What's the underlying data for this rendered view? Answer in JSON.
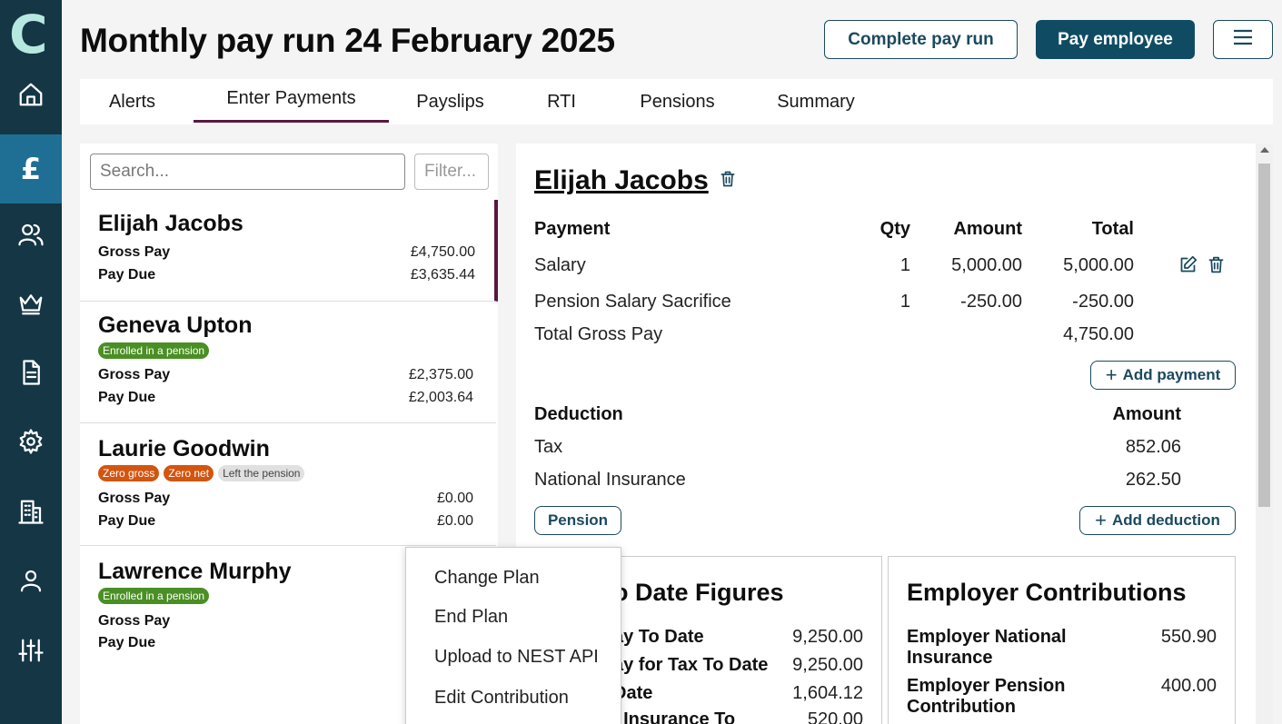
{
  "header": {
    "title": "Monthly pay run 24 February 2025",
    "complete_label": "Complete pay run",
    "pay_label": "Pay employee"
  },
  "tabs": [
    {
      "label": "Alerts"
    },
    {
      "label": "Enter Payments"
    },
    {
      "label": "Payslips"
    },
    {
      "label": "RTI"
    },
    {
      "label": "Pensions"
    },
    {
      "label": "Summary"
    }
  ],
  "sidebar": {
    "logo": "C",
    "items": [
      {
        "icon": "home-icon"
      },
      {
        "icon": "pound-icon",
        "glyph": "£",
        "active": true
      },
      {
        "icon": "users-icon"
      },
      {
        "icon": "crown-icon"
      },
      {
        "icon": "document-icon"
      },
      {
        "icon": "gear-icon"
      },
      {
        "icon": "building-icon"
      },
      {
        "icon": "user-icon"
      },
      {
        "icon": "sliders-icon"
      }
    ]
  },
  "list": {
    "search_placeholder": "Search...",
    "filter_placeholder": "Filter...",
    "employees": [
      {
        "name": "Elijah Jacobs",
        "badges": [],
        "gross_label": "Gross Pay",
        "gross": "£4,750.00",
        "due_label": "Pay Due",
        "due": "£3,635.44"
      },
      {
        "name": "Geneva Upton",
        "badges": [
          "Enrolled in a pension"
        ],
        "gross_label": "Gross Pay",
        "gross": "£2,375.00",
        "due_label": "Pay Due",
        "due": "£2,003.64"
      },
      {
        "name": "Laurie Goodwin",
        "badges": [
          "Zero gross",
          "Zero net",
          "Left the pension"
        ],
        "gross_label": "Gross Pay",
        "gross": "£0.00",
        "due_label": "Pay Due",
        "due": "£0.00"
      },
      {
        "name": "Lawrence Murphy",
        "badges": [
          "Enrolled in a pension"
        ],
        "gross_label": "Gross Pay",
        "gross": "",
        "due_label": "Pay Due",
        "due": ""
      }
    ]
  },
  "detail": {
    "name": "Elijah Jacobs",
    "payments": {
      "headers": {
        "payment": "Payment",
        "qty": "Qty",
        "amount": "Amount",
        "total": "Total"
      },
      "rows": [
        {
          "name": "Salary",
          "qty": "1",
          "amount": "5,000.00",
          "total": "5,000.00"
        },
        {
          "name": "Pension Salary Sacrifice",
          "qty": "1",
          "amount": "-250.00",
          "total": "-250.00"
        }
      ],
      "total_label": "Total Gross Pay",
      "total_value": "4,750.00",
      "add_label": "Add payment"
    },
    "deductions": {
      "headers": {
        "deduction": "Deduction",
        "amount": "Amount"
      },
      "rows": [
        {
          "name": "Tax",
          "amount": "852.06"
        },
        {
          "name": "National Insurance",
          "amount": "262.50"
        }
      ],
      "pension_label": "Pension",
      "add_label": "Add deduction"
    },
    "ytd": {
      "title": "o Date Figures",
      "rows": [
        {
          "label": "ay To Date",
          "value": "9,250.00"
        },
        {
          "label": "ay for Tax To Date",
          "value": "9,250.00"
        },
        {
          "label": "Date",
          "value": "1,604.12"
        },
        {
          "label": "l Insurance To",
          "value": "520.00"
        }
      ]
    },
    "employer": {
      "title": "Employer Contributions",
      "rows": [
        {
          "label": "Employer National Insurance",
          "value": "550.90"
        },
        {
          "label": "Employer Pension Contribution",
          "value": "400.00"
        }
      ]
    }
  },
  "context_menu": {
    "items": [
      "Change Plan",
      "End Plan",
      "Upload to NEST API",
      "Edit Contribution"
    ]
  }
}
